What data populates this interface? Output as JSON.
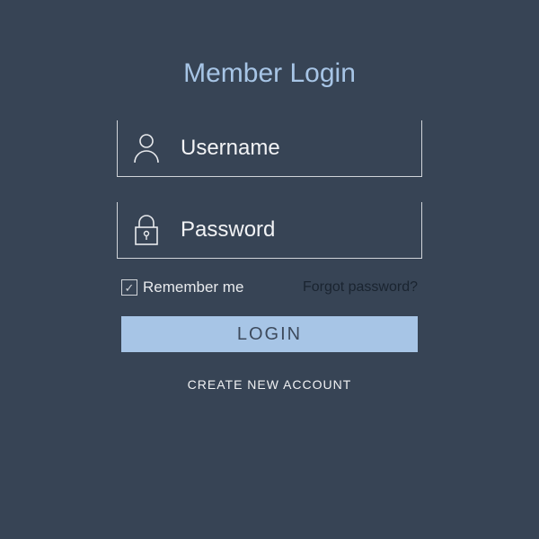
{
  "title": "Member Login",
  "fields": {
    "username": {
      "label": "Username",
      "icon": "user-icon"
    },
    "password": {
      "label": "Password",
      "icon": "lock-icon"
    }
  },
  "remember": {
    "label": "Remember me",
    "checked": true
  },
  "forgot": "Forgot password?",
  "login_button": "LOGIN",
  "create_account": "CREATE NEW ACCOUNT"
}
